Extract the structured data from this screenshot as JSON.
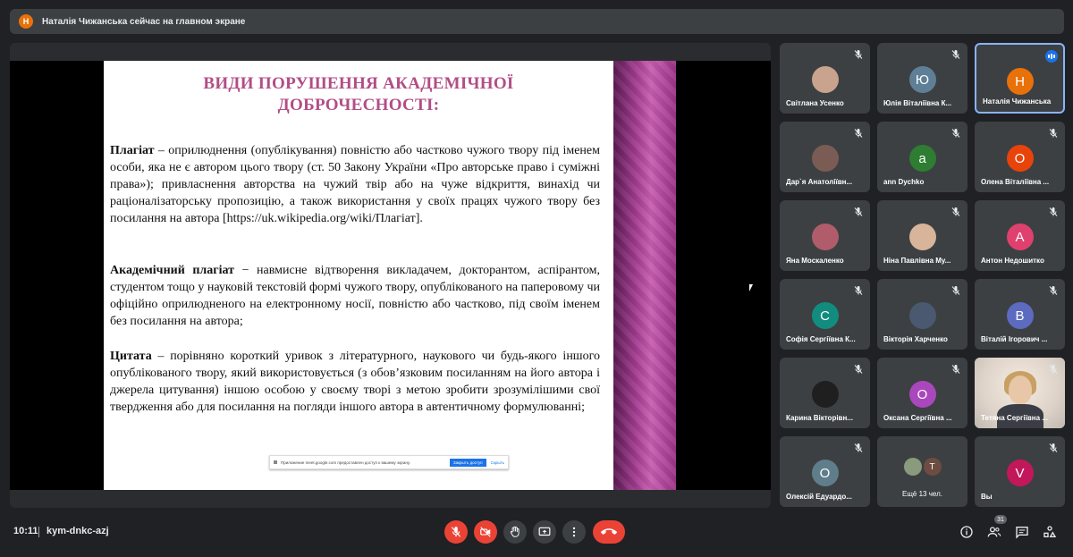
{
  "topbar": {
    "avatar_letter": "Н",
    "text": "Наталія Чижанська сейчас на главном экране"
  },
  "slide": {
    "title_line1": "ВИДИ ПОРУШЕННЯ АКАДЕМІЧНОЇ",
    "title_line2": "ДОБРОЧЕСНОСТІ:",
    "p1_term": "Плагіат",
    "p1_text": " – оприлюднення (опублікування) повністю або частково чужого твору під іменем особи, яка не є автором цього твору (ст. 50 Закону України «Про авторське право і суміжні права»); привласнення авторства на чужий твір або на чуже відкриття, винахід чи раціоналізаторську пропозицію, а також використання у своїх працях чужого твору без посилання на автора [https://uk.wikipedia.org/wiki/Плагіат].",
    "p2_term": "Академічний плагіат",
    "p2_text": " − навмисне відтворення викладачем, докторантом, аспірантом, студентом тощо у науковій текстовій формі чужого твору, опублікованого на паперовому чи офіційно оприлюдненого на електронному носії, повністю або частково, під своїм іменем без посилання на автора;",
    "p3_term": "Цитата",
    "p3_text": " – порівняно короткий уривок з літературного, наукового чи будь-якого іншого опублікованого твору, який використовується (з обов’язковим посиланням на його автора і джерела цитування) іншою особою у своєму творі з метою зробити зрозумілішими свої твердження або для посилання на погляди іншого автора в автентичному формулюванні;",
    "notice_text": "Приложение meet.google.com предоставлен доступ к вашему экрану.",
    "notice_stop": "Закрыть доступ",
    "notice_hide": "Скрыть"
  },
  "participants": [
    {
      "name": "Світлана Усенко",
      "letter": "",
      "color": "#c9a38d",
      "photo": true
    },
    {
      "name": "Юлія Віталіївна К...",
      "letter": "Ю",
      "color": "#5f7f96"
    },
    {
      "name": "Наталія Чижанська",
      "letter": "Н",
      "color": "#e8710a",
      "active": true
    },
    {
      "name": "Дар`я Анатоліївн...",
      "letter": "",
      "color": "#7a5c55",
      "photo": true
    },
    {
      "name": "ann Dychko",
      "letter": "a",
      "color": "#2e7d32"
    },
    {
      "name": "Олена Віталіївна ...",
      "letter": "О",
      "color": "#e8430a"
    },
    {
      "name": "Яна Москаленко",
      "letter": "",
      "color": "#b05c6a",
      "photo": true
    },
    {
      "name": "Ніна Павлівна Му...",
      "letter": "",
      "color": "#d8b49a",
      "photo": true
    },
    {
      "name": "Антон Недошитко",
      "letter": "А",
      "color": "#e0406d"
    },
    {
      "name": "Софія Сергіївна К...",
      "letter": "С",
      "color": "#128c7e"
    },
    {
      "name": "Вікторія Харченко",
      "letter": "",
      "color": "#4a5870",
      "photo": true
    },
    {
      "name": "Віталій Ігорович ...",
      "letter": "В",
      "color": "#5c6bc0"
    },
    {
      "name": "Карина Вікторівн...",
      "letter": "",
      "color": "#1f1f1f",
      "photo": true
    },
    {
      "name": "Оксана Сергіївна ...",
      "letter": "О",
      "color": "#ab47bc"
    },
    {
      "name": "Тетяна Сергіївна ...",
      "letter": "",
      "color": "#d4d0cc",
      "video": true
    },
    {
      "name": "Олексій Едуардо...",
      "letter": "О",
      "color": "#607d8b"
    },
    {
      "name": "Ещё 13 чел.",
      "letter": "Т",
      "color": "#6d4c41",
      "more": true
    },
    {
      "name": "Вы",
      "letter": "V",
      "color": "#c2185b"
    }
  ],
  "bottombar": {
    "time": "10:11",
    "meeting_code": "kym-dnkc-azj",
    "people_count": "31"
  },
  "colors": {
    "background": "#202124",
    "tile": "#3c4043",
    "danger": "#ea4335",
    "accent": "#8ab4f8"
  },
  "icons": [
    "mic-off-icon",
    "camera-off-icon",
    "raise-hand-icon",
    "present-icon",
    "more-options-icon",
    "end-call-icon",
    "info-icon",
    "people-icon",
    "chat-icon",
    "activities-icon"
  ]
}
